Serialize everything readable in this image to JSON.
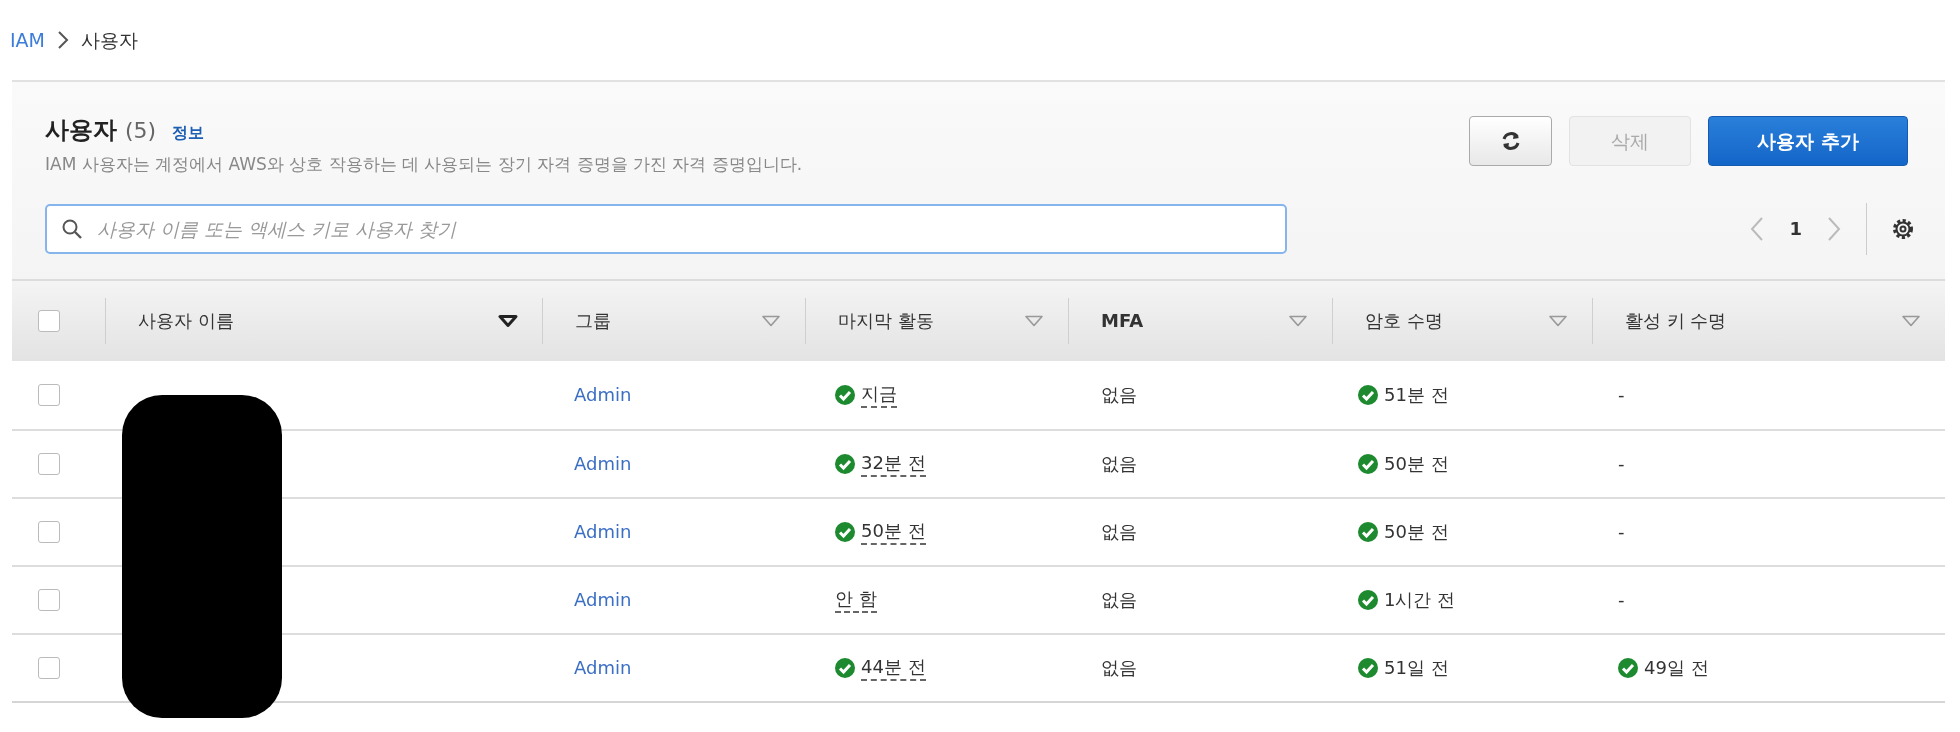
{
  "breadcrumb": [
    {
      "label": "IAM",
      "link": true
    },
    {
      "label": "사용자",
      "link": false
    }
  ],
  "header": {
    "title": "사용자",
    "count": "(5)",
    "info": "정보",
    "description": "IAM 사용자는 계정에서 AWS와 상호 작용하는 데 사용되는 장기 자격 증명을 가진 자격 증명입니다."
  },
  "buttons": [
    {
      "kind": "refresh",
      "disabled": false
    },
    {
      "kind": "text",
      "label": "삭제",
      "disabled": true
    },
    {
      "kind": "primary",
      "label": "사용자 추가",
      "disabled": false
    }
  ],
  "search": {
    "placeholder": "사용자 이름 또는 액세스 키로 사용자 찾기"
  },
  "pagination": {
    "page": "1"
  },
  "table": {
    "select_all": {
      "checked": false
    },
    "columns": [
      {
        "label": "사용자 이름",
        "sorted": true
      },
      {
        "label": "그룹",
        "sorted": false
      },
      {
        "label": "마지막 활동",
        "sorted": false
      },
      {
        "label": "MFA",
        "sorted": false
      },
      {
        "label": "암호 수명",
        "sorted": false
      },
      {
        "label": "활성 키 수명",
        "sorted": false
      }
    ],
    "rows": [
      {
        "checked": false,
        "group": "Admin",
        "last_activity": {
          "text": "지금",
          "check": true
        },
        "mfa": "없음",
        "password_age": {
          "text": "51분 전",
          "check": true
        },
        "key_age": {
          "text": "-",
          "check": false
        }
      },
      {
        "checked": false,
        "group": "Admin",
        "last_activity": {
          "text": "32분 전",
          "check": true
        },
        "mfa": "없음",
        "password_age": {
          "text": "50분 전",
          "check": true
        },
        "key_age": {
          "text": "-",
          "check": false
        }
      },
      {
        "checked": false,
        "group": "Admin",
        "last_activity": {
          "text": "50분 전",
          "check": true
        },
        "mfa": "없음",
        "password_age": {
          "text": "50분 전",
          "check": true
        },
        "key_age": {
          "text": "-",
          "check": false
        }
      },
      {
        "checked": false,
        "group": "Admin",
        "last_activity": {
          "text": "안 함",
          "check": false
        },
        "mfa": "없음",
        "password_age": {
          "text": "1시간 전",
          "check": true
        },
        "key_age": {
          "text": "-",
          "check": false
        }
      },
      {
        "checked": false,
        "group": "Admin",
        "last_activity": {
          "text": "44분 전",
          "check": true
        },
        "mfa": "없음",
        "password_age": {
          "text": "51일 전",
          "check": true
        },
        "key_age": {
          "text": "49일 전",
          "check": true
        }
      }
    ]
  }
}
